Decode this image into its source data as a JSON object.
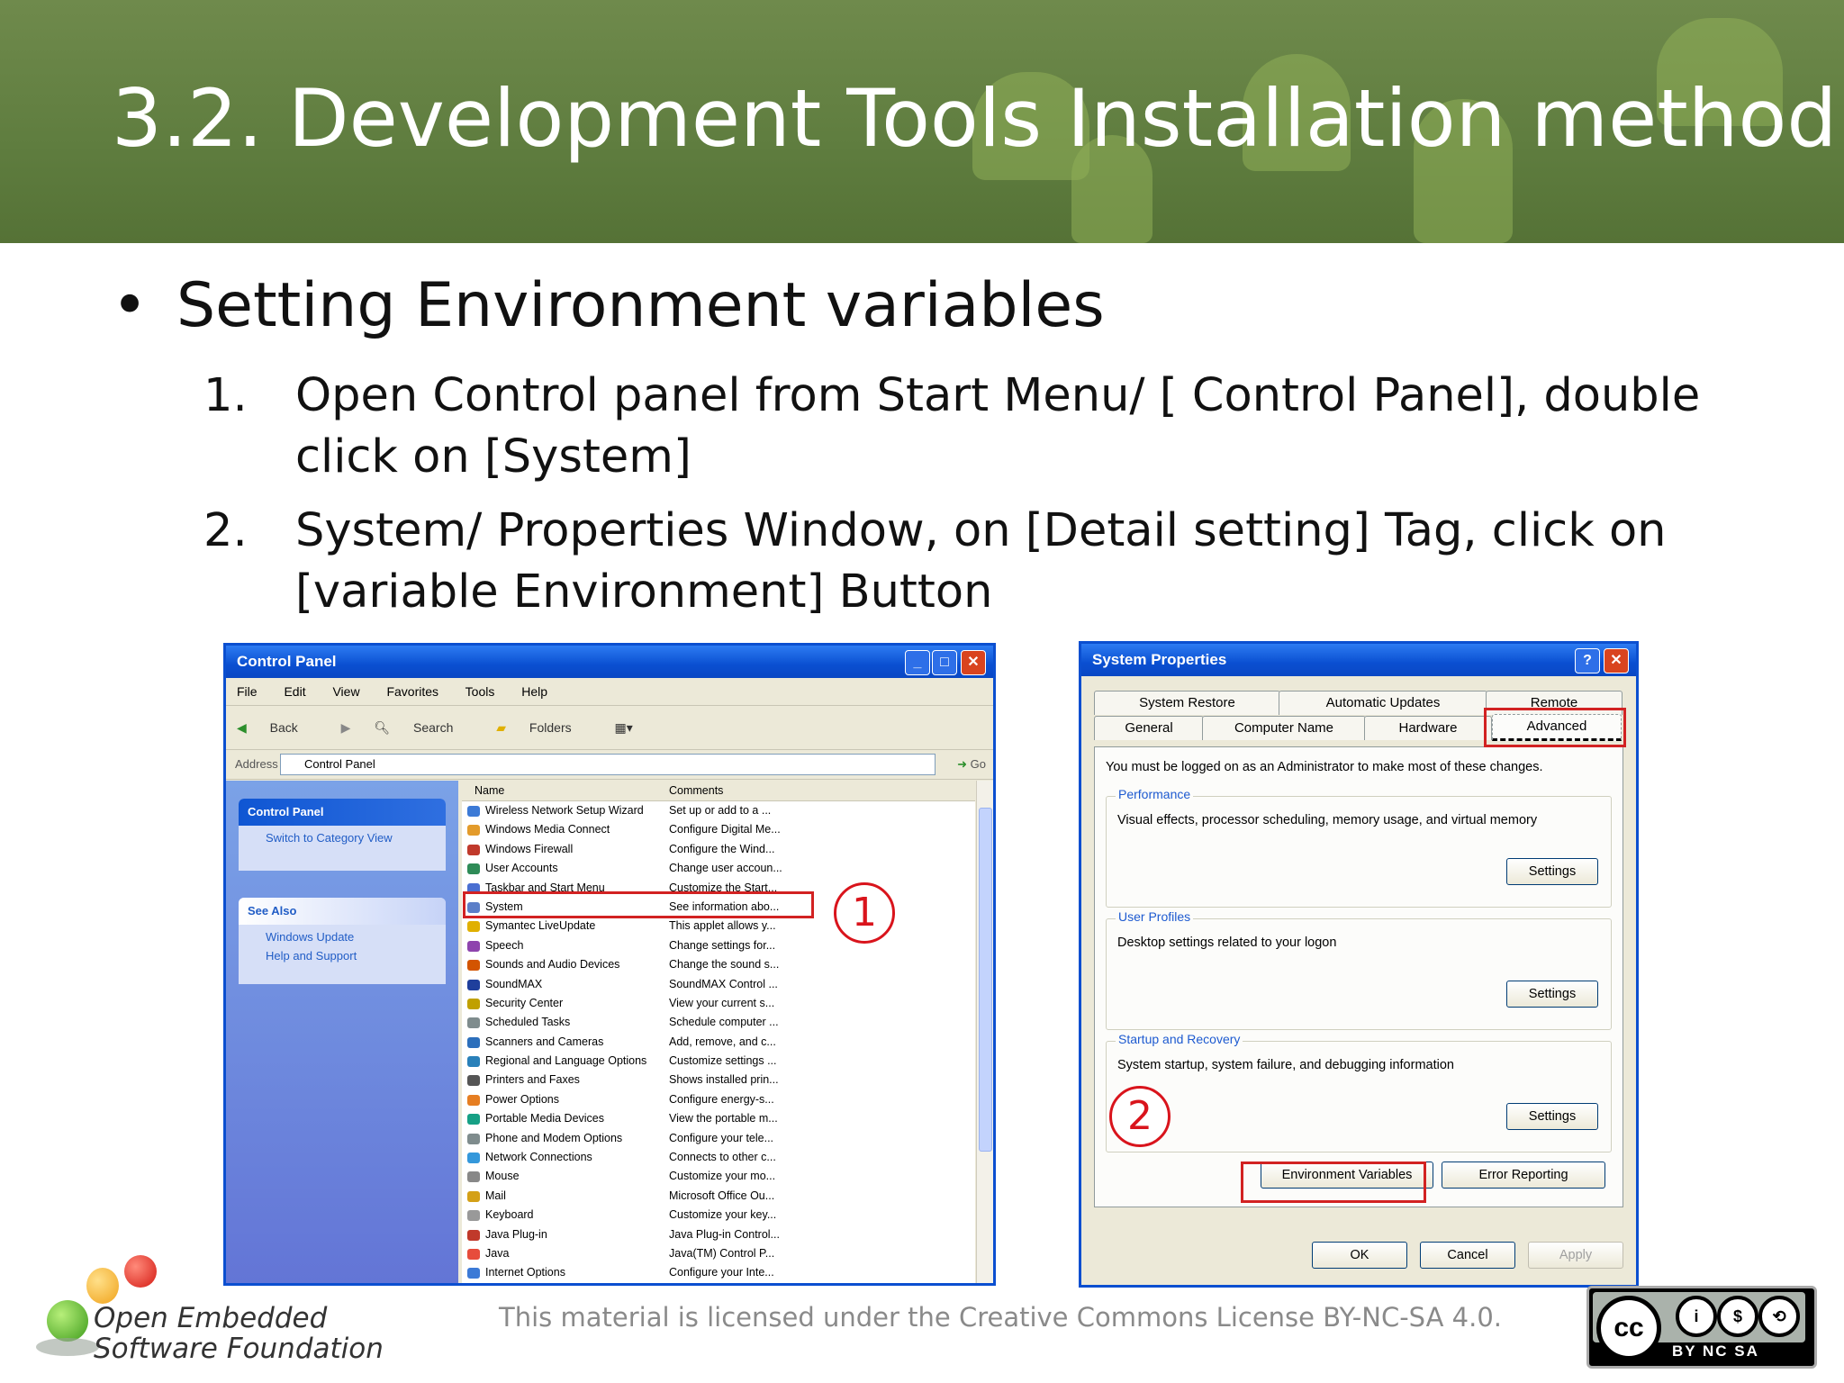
{
  "slide": {
    "title": "3.2. Development Tools Installation method",
    "bullet": "Setting Environment variables",
    "steps": [
      {
        "num": "1.",
        "text": "Open Control panel from Start Menu/ [ Control Panel], double click on [System]"
      },
      {
        "num": "2.",
        "text": "System/ Properties Window, on [Detail setting] Tag, click on [variable Environment] Button"
      }
    ],
    "footer": "This material is licensed under the Creative Commons License BY-NC-SA 4.0.",
    "logo_line1": "Open Embedded",
    "logo_line2": "Software Foundation",
    "cc_labels": "BY  NC  SA",
    "cc_logo": "cc"
  },
  "control_panel": {
    "title": "Control Panel",
    "menu": [
      "File",
      "Edit",
      "View",
      "Favorites",
      "Tools",
      "Help"
    ],
    "toolbar": [
      "Back",
      "Search",
      "Folders"
    ],
    "address_label": "Address",
    "address_value": "Control Panel",
    "go_label": "Go",
    "task_panel_title": "Control Panel",
    "task_switch": "Switch to Category View",
    "see_also_title": "See Also",
    "see_also_items": [
      "Windows Update",
      "Help and Support"
    ],
    "col_name": "Name",
    "col_comments": "Comments",
    "rows": [
      {
        "name": "Wireless Network Setup Wizard",
        "comment": "Set up or add to a ..."
      },
      {
        "name": "Windows Media Connect",
        "comment": "Configure Digital Me..."
      },
      {
        "name": "Windows Firewall",
        "comment": "Configure the Wind..."
      },
      {
        "name": "User Accounts",
        "comment": "Change user accoun..."
      },
      {
        "name": "Taskbar and Start Menu",
        "comment": "Customize the Start..."
      },
      {
        "name": "System",
        "comment": "See information abo..."
      },
      {
        "name": "Symantec LiveUpdate",
        "comment": "This applet allows y..."
      },
      {
        "name": "Speech",
        "comment": "Change settings for..."
      },
      {
        "name": "Sounds and Audio Devices",
        "comment": "Change the sound s..."
      },
      {
        "name": "SoundMAX",
        "comment": "SoundMAX Control ..."
      },
      {
        "name": "Security Center",
        "comment": "View your current s..."
      },
      {
        "name": "Scheduled Tasks",
        "comment": "Schedule computer ..."
      },
      {
        "name": "Scanners and Cameras",
        "comment": "Add, remove, and c..."
      },
      {
        "name": "Regional and Language Options",
        "comment": "Customize settings ..."
      },
      {
        "name": "Printers and Faxes",
        "comment": "Shows installed prin..."
      },
      {
        "name": "Power Options",
        "comment": "Configure energy-s..."
      },
      {
        "name": "Portable Media Devices",
        "comment": "View the portable m..."
      },
      {
        "name": "Phone and Modem Options",
        "comment": "Configure your tele..."
      },
      {
        "name": "Network Connections",
        "comment": "Connects to other c..."
      },
      {
        "name": "Mouse",
        "comment": "Customize your mo..."
      },
      {
        "name": "Mail",
        "comment": "Microsoft Office Ou..."
      },
      {
        "name": "Keyboard",
        "comment": "Customize your key..."
      },
      {
        "name": "Java Plug-in",
        "comment": "Java Plug-in Control..."
      },
      {
        "name": "Java",
        "comment": "Java(TM) Control P..."
      },
      {
        "name": "Internet Options",
        "comment": "Configure your Inte..."
      }
    ],
    "row_icon_colors": [
      "#3c7ad6",
      "#e39b2b",
      "#c0392b",
      "#2e8b57",
      "#4a6fd1",
      "#5b7ec8",
      "#e0b000",
      "#8e44ad",
      "#d35400",
      "#1f3f9c",
      "#c0a000",
      "#7f8c8d",
      "#2c6fbb",
      "#2980b9",
      "#555555",
      "#e67e22",
      "#16a085",
      "#7f8c8d",
      "#3498db",
      "#888888",
      "#d4a017",
      "#999999",
      "#c0392b",
      "#e74c3c",
      "#3c7ad6"
    ],
    "annotation": "1"
  },
  "system_properties": {
    "title": "System Properties",
    "tabs_back": [
      "System Restore",
      "Automatic Updates",
      "Remote"
    ],
    "tabs_front": [
      "General",
      "Computer Name",
      "Hardware",
      "Advanced"
    ],
    "admin_note": "You must be logged on as an Administrator to make most of these changes.",
    "groups": [
      {
        "label": "Performance",
        "text": "Visual effects, processor scheduling, memory usage, and virtual memory",
        "button": "Settings"
      },
      {
        "label": "User Profiles",
        "text": "Desktop settings related to your logon",
        "button": "Settings"
      },
      {
        "label": "Startup and Recovery",
        "text": "System startup, system failure, and debugging information",
        "button": "Settings"
      }
    ],
    "env_button": "Environment Variables",
    "error_button": "Error Reporting",
    "ok": "OK",
    "cancel": "Cancel",
    "apply": "Apply",
    "annotation": "2"
  }
}
